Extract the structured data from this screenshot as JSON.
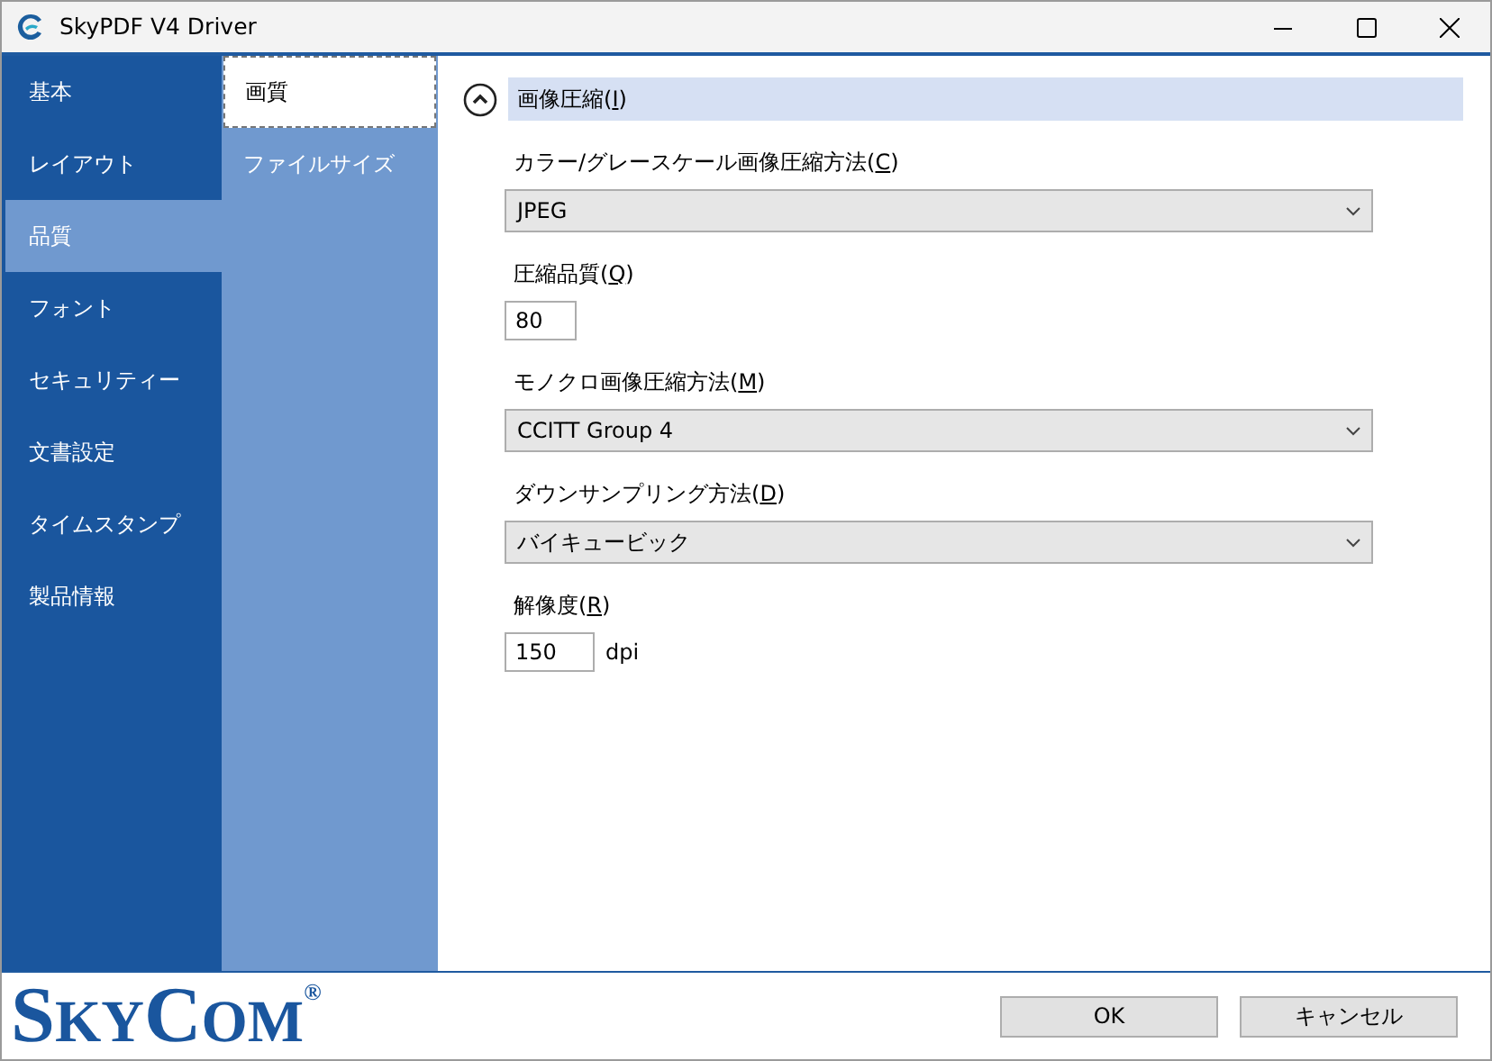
{
  "window": {
    "title": "SkyPDF V4 Driver"
  },
  "nav": [
    {
      "label": "基本",
      "selected": false
    },
    {
      "label": "レイアウト",
      "selected": false
    },
    {
      "label": "品質",
      "selected": true
    },
    {
      "label": "フォント",
      "selected": false
    },
    {
      "label": "セキュリティー",
      "selected": false
    },
    {
      "label": "文書設定",
      "selected": false
    },
    {
      "label": "タイムスタンプ",
      "selected": false
    },
    {
      "label": "製品情報",
      "selected": false
    }
  ],
  "subnav": [
    {
      "label": "画質",
      "selected": true
    },
    {
      "label": "ファイルサイズ",
      "selected": false
    }
  ],
  "section": {
    "expanded": true,
    "label_before": "画像圧縮(",
    "access_key": "I",
    "label_after": ")"
  },
  "fields": [
    {
      "kind": "select",
      "label_before": "カラー/グレースケール画像圧縮方法(",
      "access_key": "C",
      "label_after": ")",
      "value": "JPEG"
    },
    {
      "kind": "input",
      "label_before": "圧縮品質(",
      "access_key": "Q",
      "label_after": ")",
      "value": "80"
    },
    {
      "kind": "select",
      "label_before": "モノクロ画像圧縮方法(",
      "access_key": "M",
      "label_after": ")",
      "value": "CCITT Group 4"
    },
    {
      "kind": "select",
      "label_before": "ダウンサンプリング方法(",
      "access_key": "D",
      "label_after": ")",
      "value": "バイキュービック"
    },
    {
      "kind": "input",
      "label_before": "解像度(",
      "access_key": "R",
      "label_after": ")",
      "value": "150",
      "unit": "dpi"
    }
  ],
  "logo": {
    "parts": [
      {
        "text": "S",
        "large": true
      },
      {
        "text": "KY",
        "large": false
      },
      {
        "text": "C",
        "large": true
      },
      {
        "text": "OM",
        "large": false
      }
    ],
    "mark": "®"
  },
  "buttons": [
    "OK",
    "キャンセル"
  ]
}
